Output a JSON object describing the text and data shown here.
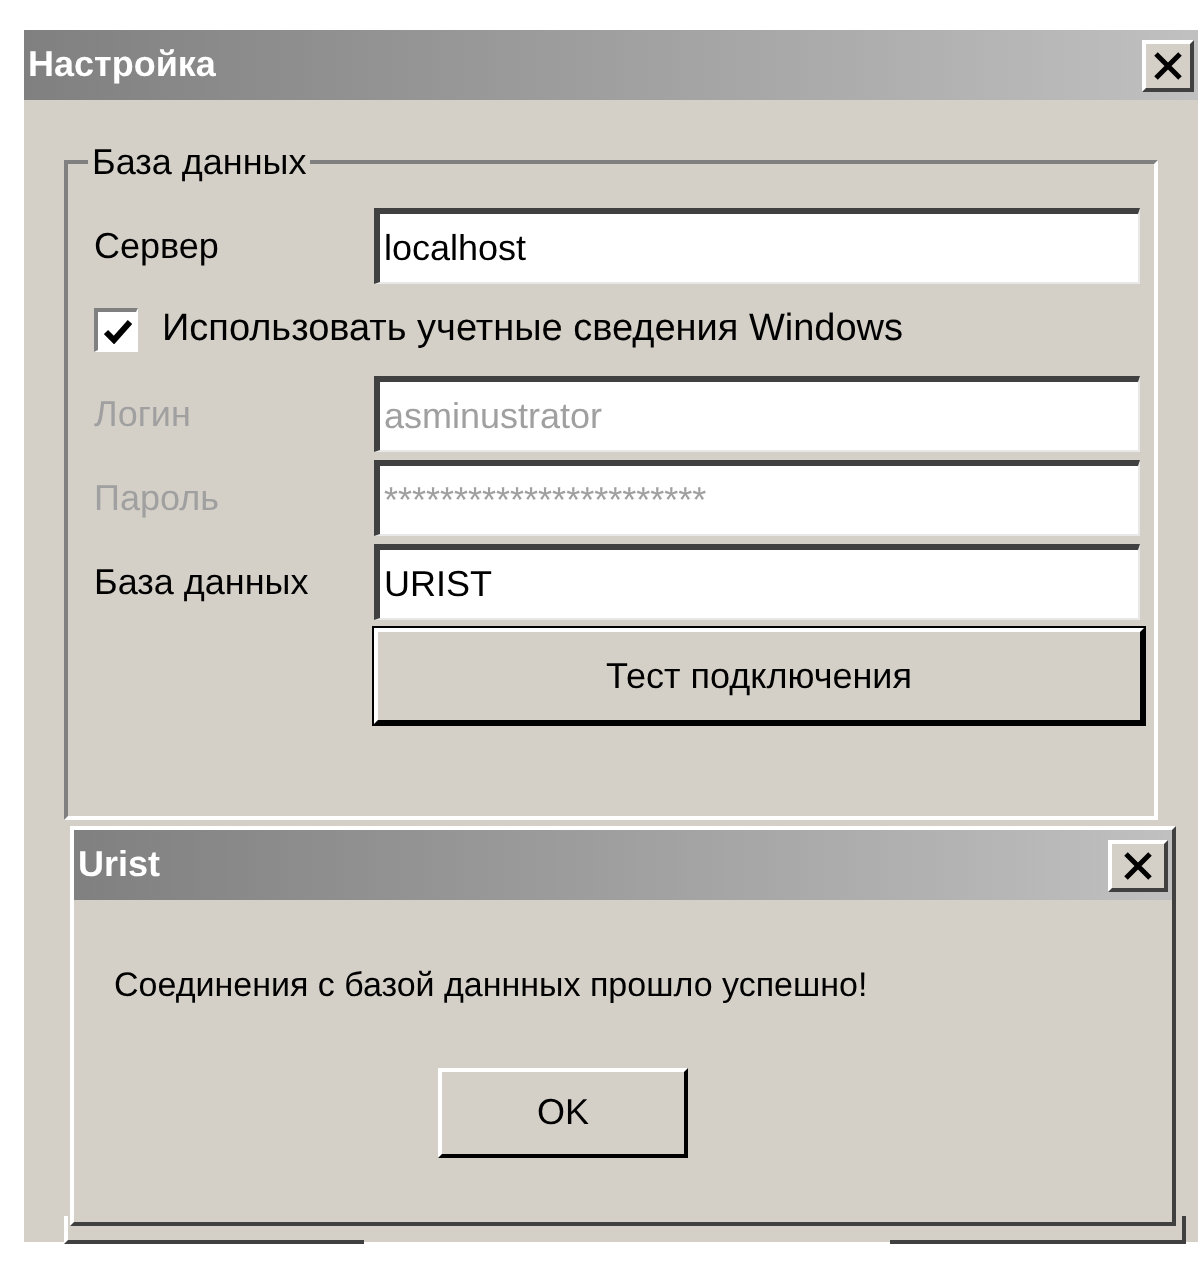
{
  "window": {
    "title": "Настройка"
  },
  "group": {
    "legend": "База данных"
  },
  "fields": [
    {
      "label": "Сервер",
      "value": "localhost",
      "disabled": false
    },
    {
      "kind": "checkbox",
      "label": "Использовать учетные сведения Windows",
      "checked": true
    },
    {
      "label": "Логин",
      "value": "asminustrator",
      "disabled": true
    },
    {
      "label": "Пароль",
      "value": "***********************",
      "disabled": true
    },
    {
      "label": "База данных",
      "value": "URIST",
      "disabled": false
    }
  ],
  "test_button": "Тест подключения",
  "message_box": {
    "title": "Urist",
    "message": "Соединения с базой даннных прошло успешно!",
    "button": "OK"
  }
}
